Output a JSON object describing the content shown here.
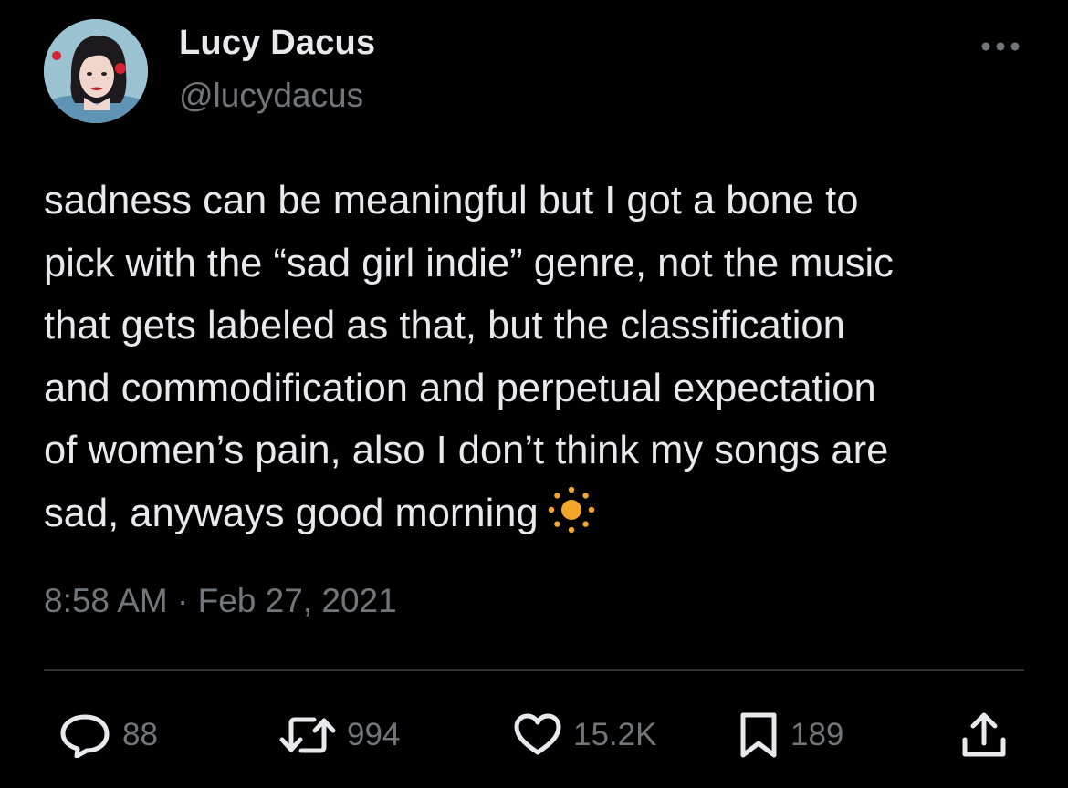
{
  "tweet": {
    "author": {
      "display_name": "Lucy Dacus",
      "handle": "@lucydacus"
    },
    "text": "sadness can be meaningful but I got a bone to\npick with the “sad girl indie” genre, not the music\nthat gets labeled as that, but the classification\nand commodification and perpetual expectation\nof women’s pain, also I don’t think my songs are\nsad, anyways good morning",
    "emoji": "sun-icon",
    "timestamp": "8:58 AM · Feb 27, 2021"
  },
  "actions": {
    "replies": "88",
    "retweets": "994",
    "likes": "15.2K",
    "bookmarks": "189"
  },
  "colors": {
    "background": "#000000",
    "primary_text": "#e7e9ea",
    "secondary_text": "#71767b",
    "divider": "#2f3336",
    "emoji_sun": "#f4a62a"
  }
}
